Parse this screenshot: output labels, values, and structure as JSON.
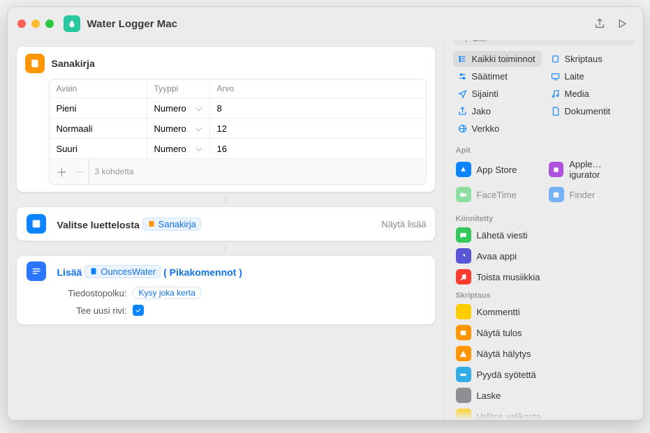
{
  "window": {
    "title": "Water Logger Mac"
  },
  "search": {
    "placeholder": "Etsi"
  },
  "dictionary": {
    "title": "Sanakirja",
    "headers": {
      "key": "Avain",
      "type": "Tyyppi",
      "value": "Arvo"
    },
    "rows": [
      {
        "key": "Pieni",
        "type": "Numero",
        "value": "8"
      },
      {
        "key": "Normaali",
        "type": "Numero",
        "value": "12"
      },
      {
        "key": "Suuri",
        "type": "Numero",
        "value": "16"
      }
    ],
    "count_label": "3 kohdetta"
  },
  "choose": {
    "prefix": "Valitse luettelosta",
    "token": "Sanakirja",
    "show_more": "Näytä lisää"
  },
  "append": {
    "prefix": "Lisää",
    "file_token": "OuncesWater",
    "paren_open": "(",
    "app_token": "Pikakomennot",
    "paren_close": ")",
    "filepath_label": "Tiedostopolku:",
    "ask_each_time": "Kysy joka kerta",
    "newline_label": "Tee uusi rivi:"
  },
  "categories": [
    {
      "label": "Kaikki toiminnot",
      "icon": "list",
      "active": true
    },
    {
      "label": "Skriptaus",
      "icon": "script",
      "active": false
    },
    {
      "label": "Säätimet",
      "icon": "sliders",
      "active": false
    },
    {
      "label": "Laite",
      "icon": "device",
      "active": false
    },
    {
      "label": "Sijainti",
      "icon": "location",
      "active": false
    },
    {
      "label": "Media",
      "icon": "media",
      "active": false
    },
    {
      "label": "Jako",
      "icon": "share",
      "active": false
    },
    {
      "label": "Dokumentit",
      "icon": "doc",
      "active": false
    },
    {
      "label": "Verkko",
      "icon": "web",
      "active": false
    }
  ],
  "apps_header": "Apit",
  "apps": [
    {
      "label": "App Store",
      "color": "sq-blue"
    },
    {
      "label": "Apple…igurator",
      "color": "sq-purple"
    },
    {
      "label": "FaceTime",
      "color": "sq-teal"
    },
    {
      "label": "Finder",
      "color": "sq-dkblue"
    }
  ],
  "pinned_header": "Kiinnitetty",
  "pinned": [
    {
      "label": "Lähetä viesti",
      "color": "sq-green",
      "icon": "message"
    },
    {
      "label": "Avaa appi",
      "color": "sq-indigo",
      "icon": "open"
    },
    {
      "label": "Toista musiikkia",
      "color": "sq-red",
      "icon": "music"
    }
  ],
  "scripting_header": "Skriptaus",
  "scripting": [
    {
      "label": "Kommentti",
      "color": "sq-yellow"
    },
    {
      "label": "Näytä tulos",
      "color": "sq-orange"
    },
    {
      "label": "Näytä hälytys",
      "color": "sq-orange"
    },
    {
      "label": "Pyydä syötettä",
      "color": "sq-cyan"
    },
    {
      "label": "Laske",
      "color": "sq-gray"
    },
    {
      "label": "Valitse valikosta",
      "color": "sq-yellow"
    }
  ]
}
